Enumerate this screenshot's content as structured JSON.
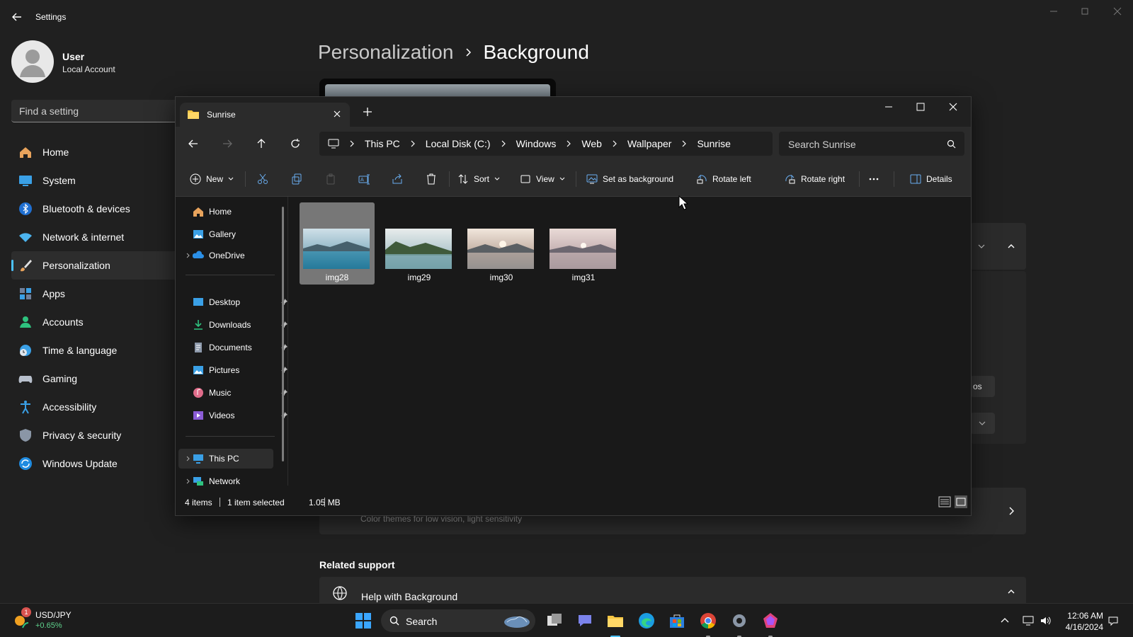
{
  "settings": {
    "title": "Settings",
    "user": {
      "name": "User",
      "subtitle": "Local Account"
    },
    "search_placeholder": "Find a setting",
    "nav": [
      {
        "label": "Home",
        "icon": "home-icon"
      },
      {
        "label": "System",
        "icon": "system-icon"
      },
      {
        "label": "Bluetooth & devices",
        "icon": "bluetooth-icon"
      },
      {
        "label": "Network & internet",
        "icon": "wifi-icon"
      },
      {
        "label": "Personalization",
        "icon": "brush-icon",
        "active": true
      },
      {
        "label": "Apps",
        "icon": "apps-icon"
      },
      {
        "label": "Accounts",
        "icon": "accounts-icon"
      },
      {
        "label": "Time & language",
        "icon": "globe-clock-icon"
      },
      {
        "label": "Gaming",
        "icon": "gamepad-icon"
      },
      {
        "label": "Accessibility",
        "icon": "accessibility-icon"
      },
      {
        "label": "Privacy & security",
        "icon": "shield-icon"
      },
      {
        "label": "Windows Update",
        "icon": "update-icon"
      }
    ],
    "breadcrumb": {
      "parent": "Personalization",
      "current": "Background"
    },
    "contrast_subtitle": "Color themes for low vision, light sensitivity",
    "browse_button_partial": "os",
    "related_support": "Related support",
    "help_item": "Help with Background"
  },
  "explorer": {
    "tab_title": "Sunrise",
    "path": [
      "This PC",
      "Local Disk (C:)",
      "Windows",
      "Web",
      "Wallpaper",
      "Sunrise"
    ],
    "search_placeholder": "Search Sunrise",
    "commands": {
      "new": "New",
      "sort": "Sort",
      "view": "View",
      "set_background": "Set as background",
      "rotate_left": "Rotate left",
      "rotate_right": "Rotate right",
      "details": "Details"
    },
    "nav_tree": {
      "top": [
        "Home",
        "Gallery",
        "OneDrive"
      ],
      "quick": [
        "Desktop",
        "Downloads",
        "Documents",
        "Pictures",
        "Music",
        "Videos"
      ],
      "bottom": [
        "This PC",
        "Network"
      ]
    },
    "files": [
      {
        "name": "img28",
        "selected": true
      },
      {
        "name": "img29",
        "selected": false
      },
      {
        "name": "img30",
        "selected": false
      },
      {
        "name": "img31",
        "selected": false
      }
    ],
    "status": {
      "count": "4 items",
      "selection": "1 item selected",
      "size": "1.05 MB"
    }
  },
  "taskbar": {
    "widget_badge": "1",
    "ticker_symbol": "USD/JPY",
    "ticker_change": "+0.65%",
    "search_label": "Search",
    "time": "12:06 AM",
    "date": "4/16/2024"
  },
  "colors": {
    "accent": "#4cc2ff",
    "background": "#202020",
    "explorer_bg": "#191919"
  }
}
